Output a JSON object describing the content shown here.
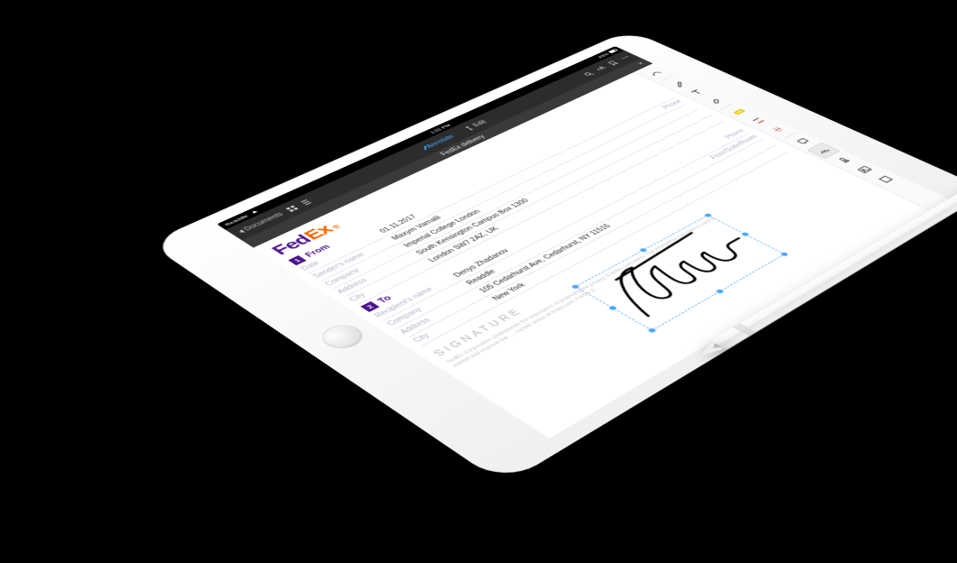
{
  "statusbar": {
    "carrier": "Readdle",
    "time": "1:01 PM",
    "battery": "83%"
  },
  "topbar": {
    "back_label": "Documents",
    "tab_annotate": "Annotate",
    "tab_edit": "Edit"
  },
  "tabstrip": {
    "title": "FedEx delivery",
    "close": "×"
  },
  "brand": {
    "p1": "Fed",
    "p2": "Ex",
    "reg": "®"
  },
  "sections": {
    "from": {
      "num": "1",
      "title": "From"
    },
    "to": {
      "num": "2",
      "title": "To"
    }
  },
  "from": {
    "date_label": "Date",
    "date_value": "01.11.2017",
    "sender_label": "Sender's name",
    "sender_value": "Maxym Varnalii",
    "phone_label": "Phone",
    "company_label": "Company",
    "company_value": "Imperial College London",
    "address_label": "Address",
    "address_value": "South Kensington Campus Box 1300",
    "city_label": "City",
    "city_value": "London SW7 2AZ, UK"
  },
  "to": {
    "recipient_label": "Recipient's name",
    "recipient_value": "Denys Zhadanov",
    "phone_label": "Phone",
    "company_label": "Company",
    "company_value": "Readdle",
    "floor_label": "Floor/Suite/Room",
    "address_label": "Address",
    "address_value": "105 Cedarhurst Ave, Cedarhurst, NY 11516",
    "city_label": "City",
    "city_value": "New York"
  },
  "signature": {
    "label": "SIGNATURE"
  },
  "disclaimer": "FedEx Corporation understands the importance of protecting the privacy of fedex.com users. The information collected is used to market and improve the … Certain areas of fedex.com, FedEx S…"
}
